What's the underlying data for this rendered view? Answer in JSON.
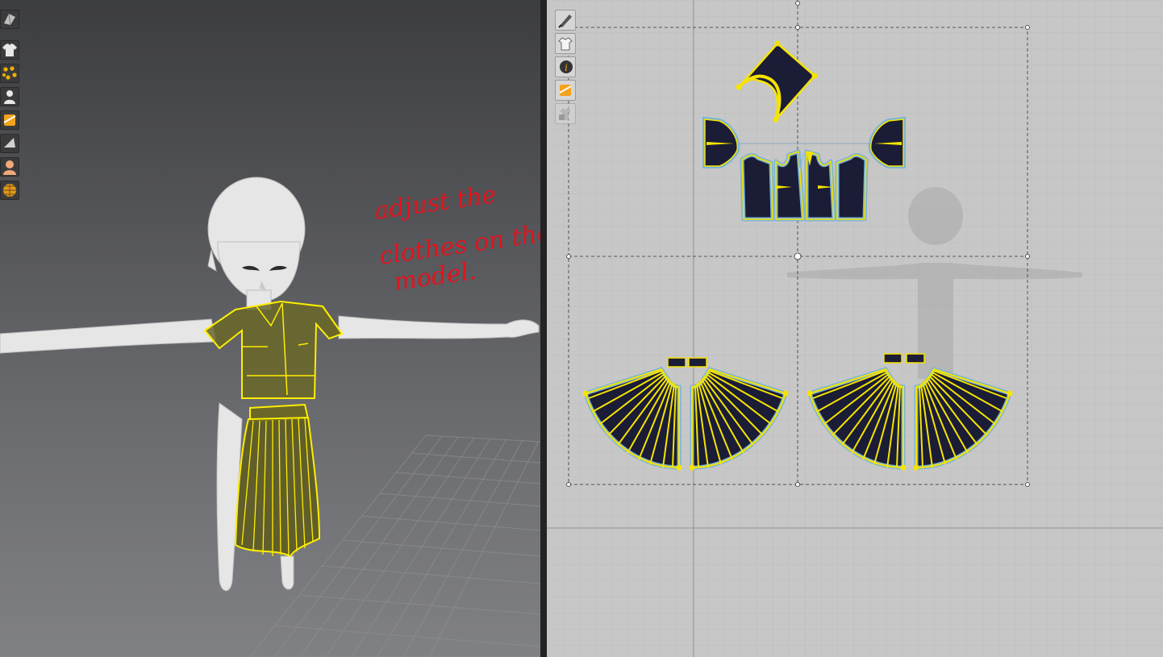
{
  "annotation": {
    "lines": [
      "adjust the",
      "clothes on the",
      "model."
    ],
    "color": "#e0141e"
  },
  "toolbar_3d": {
    "tools": [
      {
        "name": "simulation-mode-icon"
      },
      {
        "name": "garment-select-icon"
      },
      {
        "name": "tack-points-icon"
      },
      {
        "name": "avatar-pose-icon"
      },
      {
        "name": "fabric-icon"
      },
      {
        "name": "fold-arrangement-icon"
      },
      {
        "name": "avatar-display-icon"
      },
      {
        "name": "world-grid-icon"
      }
    ]
  },
  "toolbar_2d": {
    "tools": [
      {
        "name": "edit-pattern-icon"
      },
      {
        "name": "show-garment-icon"
      },
      {
        "name": "pattern-info-icon"
      },
      {
        "name": "fabric-texture-icon"
      },
      {
        "name": "locked-layer-icon"
      }
    ]
  },
  "colors": {
    "pattern_fill": "#1b1c36",
    "pattern_outline": "#f5e400",
    "pattern_halo": "#7db4d6",
    "garment_highlight": "#ffee00"
  }
}
